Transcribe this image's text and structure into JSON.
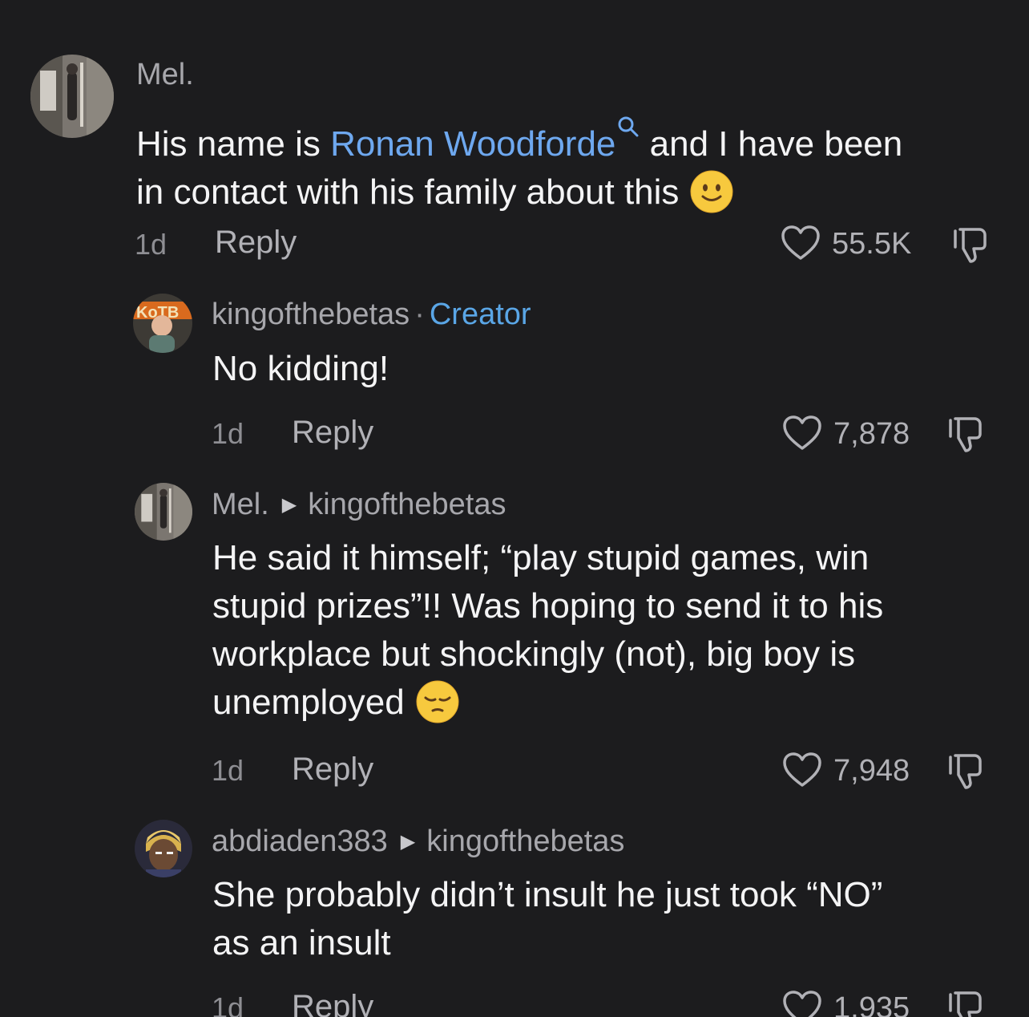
{
  "comments": [
    {
      "username": "Mel.",
      "text_before": "His name is ",
      "link": "Ronan Woodforde",
      "text_line1_after": " and I have been",
      "text_line2": "in contact with his family about this",
      "emoji": "slightly-smiling-face",
      "time": "1d",
      "reply_label": "Reply",
      "likes": "55.5K"
    },
    {
      "username": "kingofthebetas",
      "badge_sep": "·",
      "badge": "Creator",
      "text": "No kidding!",
      "time": "1d",
      "reply_label": "Reply",
      "likes": "7,878"
    },
    {
      "username": "Mel.",
      "reply_to": "kingofthebetas",
      "lines": [
        "He said it himself; “play stupid games, win",
        "stupid prizes”!! Was hoping to send it to his",
        "workplace but shockingly (not), big boy is",
        "unemployed"
      ],
      "emoji": "pensive-face",
      "time": "1d",
      "reply_label": "Reply",
      "likes": "7,948"
    },
    {
      "username": "abdiaden383",
      "reply_to": "kingofthebetas",
      "lines": [
        "She probably didn’t insult he just took “NO”",
        "as an insult"
      ],
      "time": "1d",
      "reply_label": "Reply",
      "likes": "1,935"
    }
  ],
  "colors": {
    "background": "#1c1c1e",
    "link": "#6ea8ef",
    "creator_badge": "#5aa6e6",
    "secondary_text": "#a7a7ac"
  }
}
